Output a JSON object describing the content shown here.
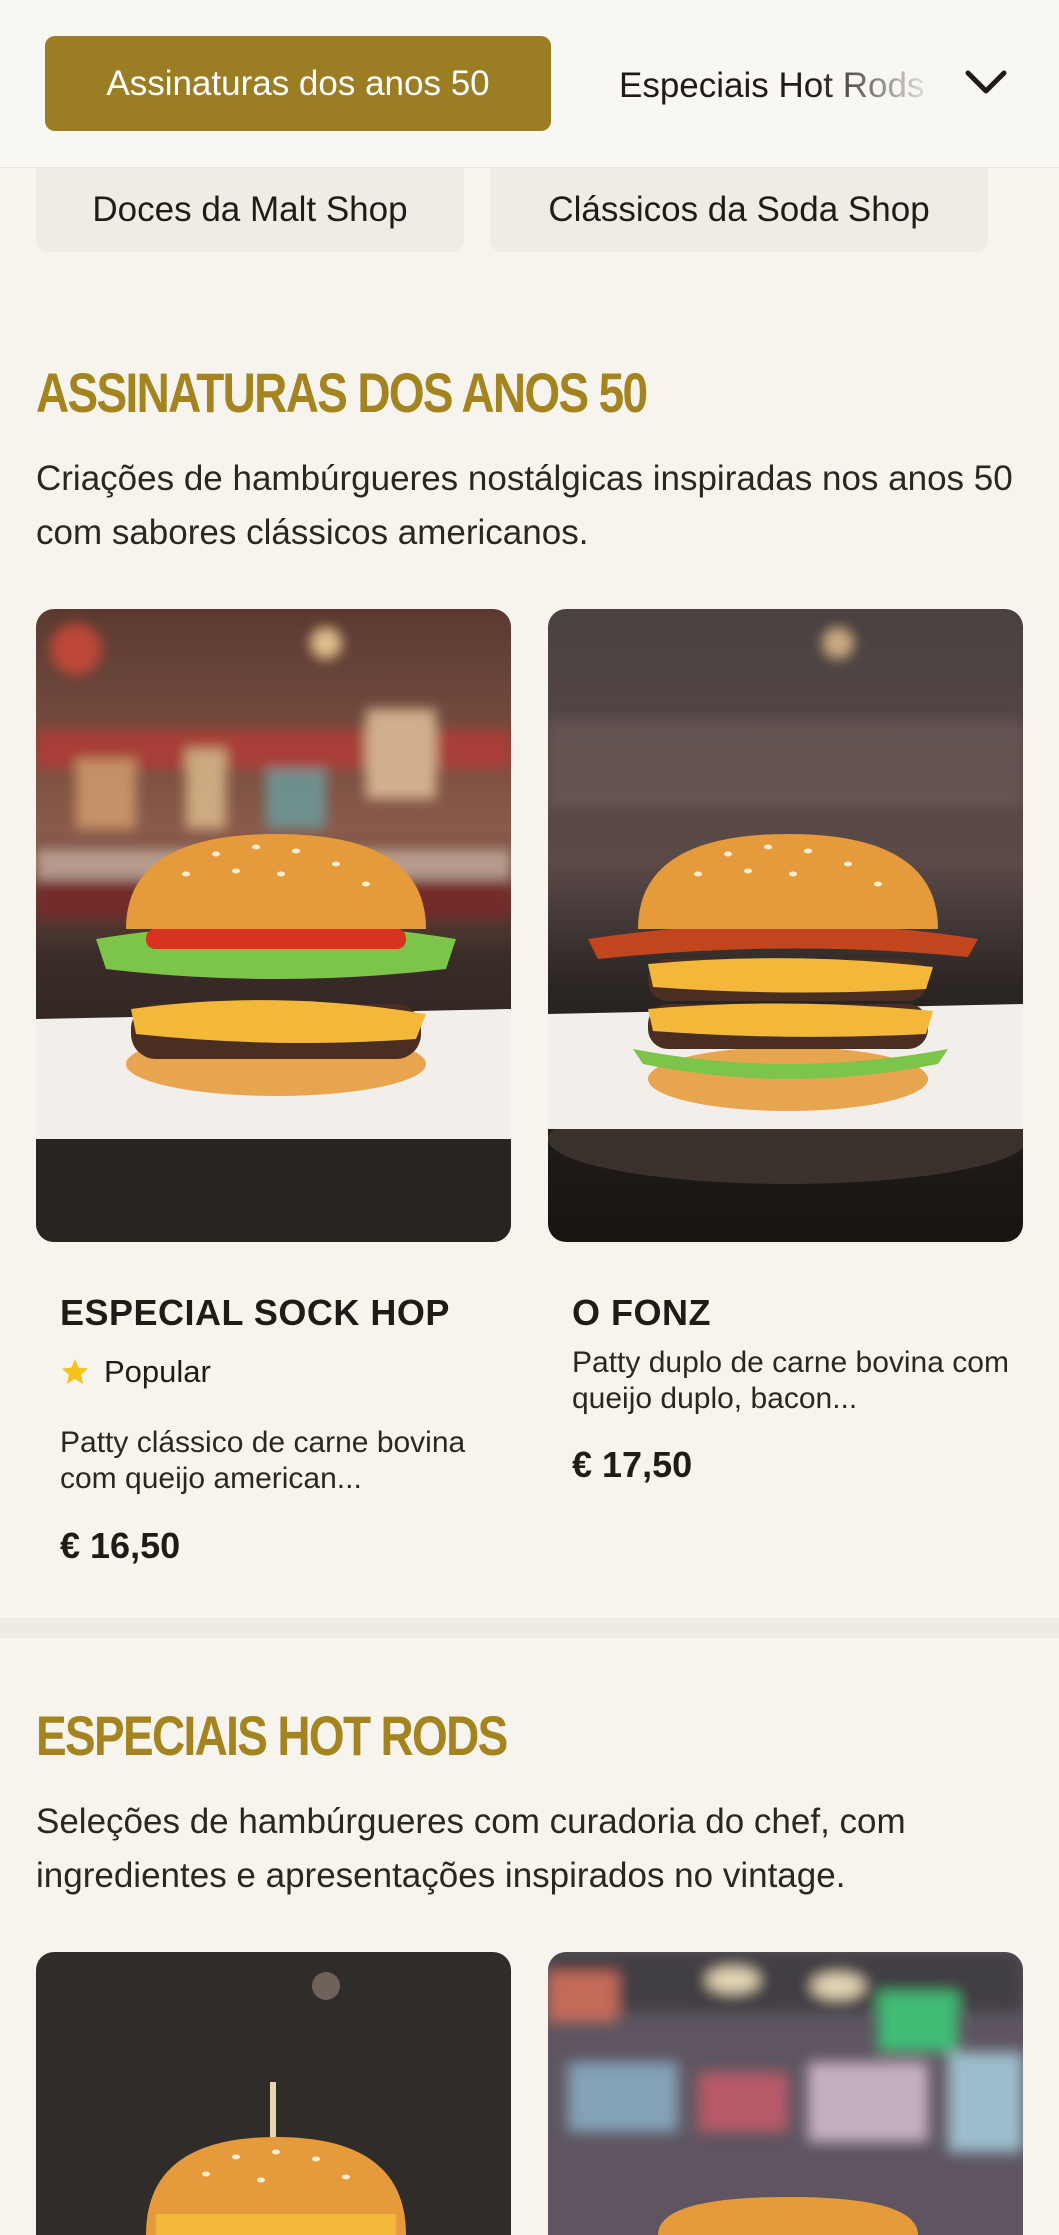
{
  "nav": {
    "active_tab": "Assinaturas dos anos 50",
    "next_tab": "Especiais Hot Rods",
    "chips": [
      "Doces da Malt Shop",
      "Clássicos da Soda Shop"
    ]
  },
  "sections": [
    {
      "title": "ASSINATURAS DOS ANOS 50",
      "description": "Criações de hambúrgueres nostálgicas inspiradas nos anos 50 com sabores clássicos americanos.",
      "items": [
        {
          "name": "ESPECIAL SOCK HOP",
          "badge": "Popular",
          "description": "Patty clássico de carne bovina com queijo american...",
          "price": "€ 16,50"
        },
        {
          "name": "O FONZ",
          "description": "Patty duplo de carne bovina com queijo duplo, bacon...",
          "price": "€ 17,50"
        }
      ]
    },
    {
      "title": "ESPECIAIS HOT RODS",
      "description": "Seleções de hambúrgueres com curadoria do chef, com ingredientes e apresentações inspirados no vintage."
    }
  ],
  "colors": {
    "accent": "#9b7d24",
    "title": "#a3841f",
    "background": "#f7f4ee",
    "star": "#f4c21a"
  },
  "icons": {
    "dropdown": "chevron-down-icon",
    "badge": "star-icon"
  }
}
